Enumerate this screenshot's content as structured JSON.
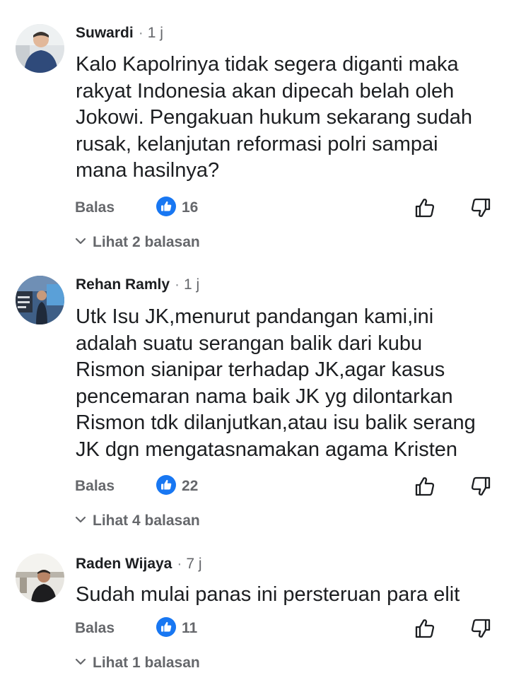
{
  "colors": {
    "like_badge": "#1877f2",
    "muted_text": "#65676b",
    "primary_text": "#1c1e21"
  },
  "icons": {
    "like_badge": "thumbs-up-badge-icon",
    "like_action": "thumbs-up-outline-icon",
    "dislike_action": "thumbs-down-outline-icon",
    "expand": "chevron-down-icon"
  },
  "comments": [
    {
      "author": "Suwardi",
      "separator": "·",
      "time": "1 j",
      "text_lines": [
        "Kalo Kapolrinya tidak segera diganti maka",
        "rakyat Indonesia akan dipecah belah oleh",
        "Jokowi. Pengakuan hukum sekarang sudah",
        "rusak, kelanjutan reformasi polri sampai",
        "mana hasilnya?"
      ],
      "reply_label": "Balas",
      "like_count": "16",
      "view_replies_label": "Lihat 2 balasan"
    },
    {
      "author": "Rehan Ramly",
      "separator": "·",
      "time": "1 j",
      "text_lines": [
        "Utk Isu JK,menurut pandangan kami,ini",
        "adalah suatu serangan balik dari kubu",
        "Rismon sianipar terhadap JK,agar kasus",
        "pencemaran nama baik JK yg dilontarkan",
        "Rismon tdk dilanjutkan,atau isu balik serang",
        "JK dgn mengatasnamakan agama Kristen"
      ],
      "reply_label": "Balas",
      "like_count": "22",
      "view_replies_label": "Lihat 4 balasan"
    },
    {
      "author": "Raden Wijaya",
      "separator": "·",
      "time": "7 j",
      "text_lines": [
        "Sudah mulai panas ini persteruan para elit"
      ],
      "reply_label": "Balas",
      "like_count": "11",
      "view_replies_label": "Lihat 1 balasan"
    }
  ]
}
